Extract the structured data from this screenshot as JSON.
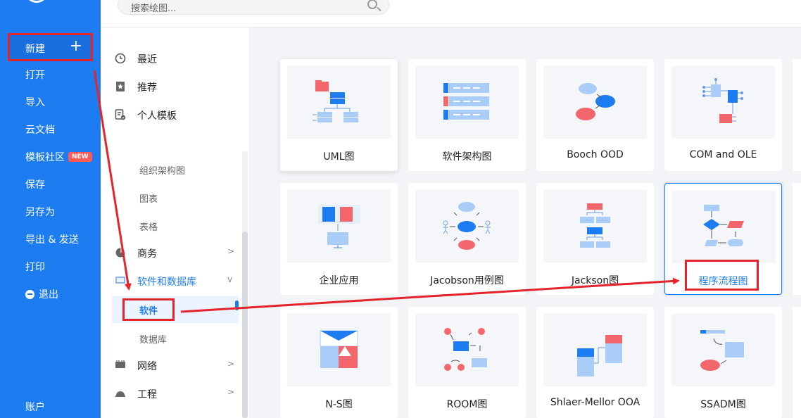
{
  "sidebar": {
    "new_label": "新建",
    "new_plus": "+",
    "items": [
      "打开",
      "导入",
      "云文档",
      "模板社区",
      "保存",
      "另存为",
      "导出 & 发送",
      "打印",
      "退出",
      "账户"
    ],
    "badge": "NEW"
  },
  "search": {
    "placeholder": "搜索绘图..."
  },
  "categories": {
    "top": [
      "最近",
      "推荐",
      "个人模板"
    ],
    "sub_general": [
      "组织架构图",
      "图表",
      "表格"
    ],
    "business": "商务",
    "software_db": "软件和数据库",
    "software": "软件",
    "database": "数据库",
    "network": "网络",
    "engineering": "工程"
  },
  "templates": [
    "UML图",
    "软件架构图",
    "Booch OOD",
    "COM and OLE",
    "企业应用",
    "Jacobson用例图",
    "Jackson图",
    "程序流程图",
    "N-S图",
    "ROOM图",
    "Shlaer-Mellor OOA",
    "SSADM图"
  ],
  "colors": {
    "accent": "#1d7cf0",
    "annotation": "#e5232a",
    "red": "#f2666c",
    "light_blue": "#a9cdf6"
  }
}
